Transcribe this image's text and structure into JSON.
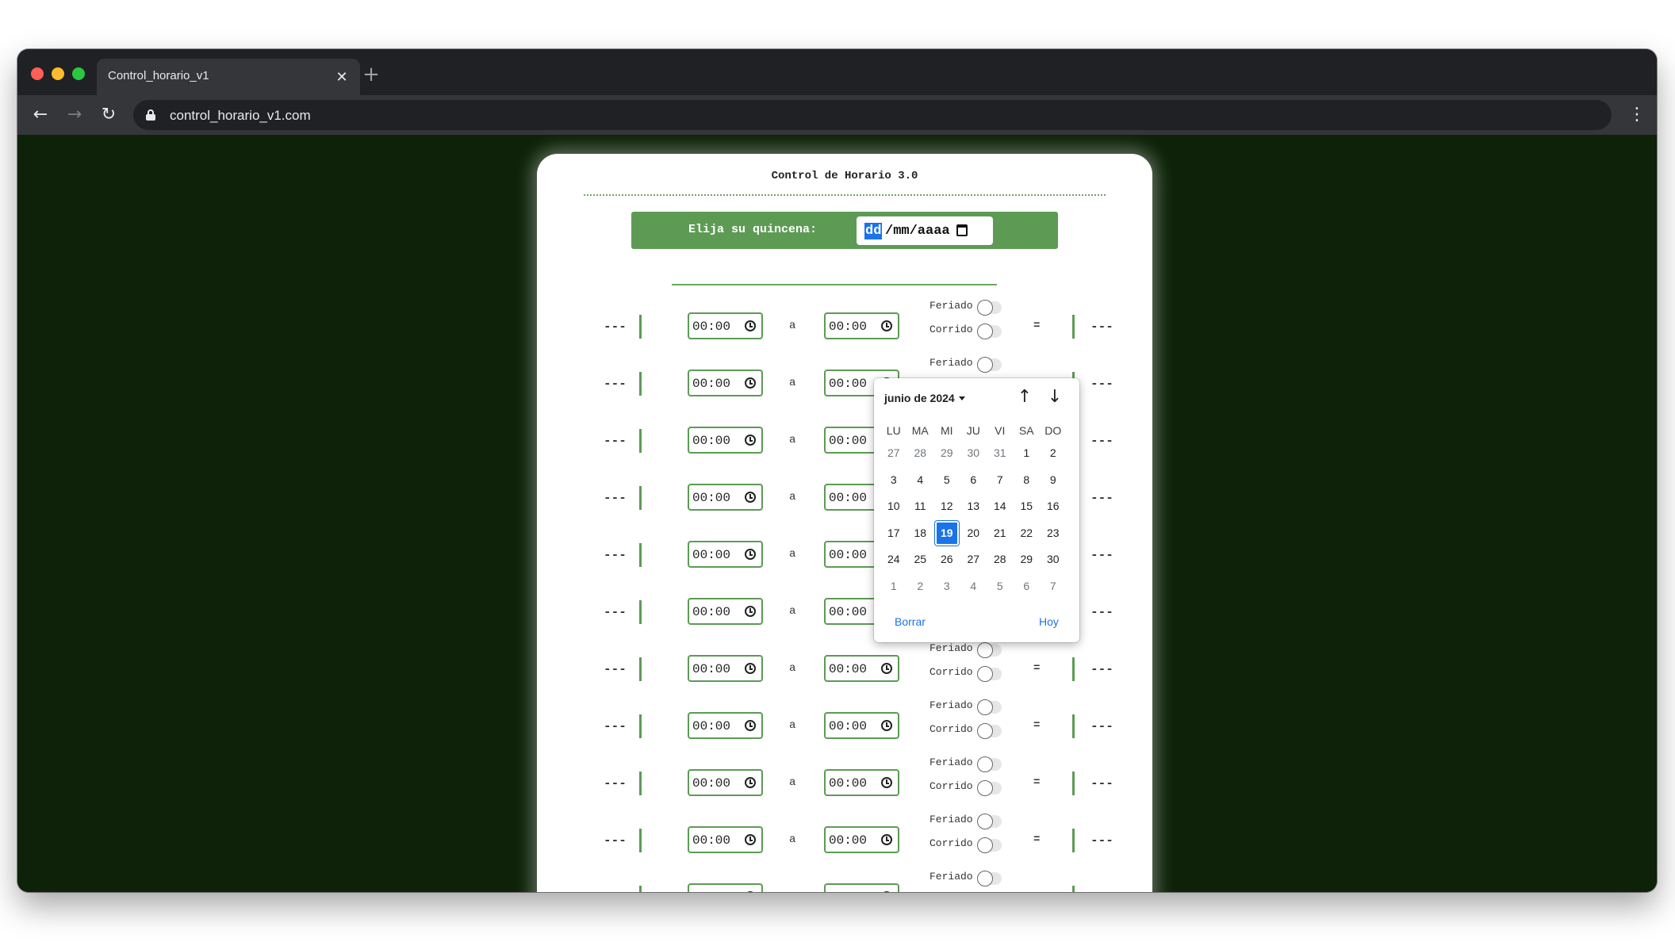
{
  "browser": {
    "tab_title": "Control_horario_v1",
    "tab_close": "✕",
    "new_tab": "+",
    "back": "←",
    "forward": "→",
    "reload": "↻",
    "url": "control_horario_v1.com",
    "menu": "⋮"
  },
  "page": {
    "title": "Control de Horario 3.0",
    "quincena_label": "Elija su quincena:",
    "date_day": "dd",
    "date_rest": "/mm/aaaa"
  },
  "labels": {
    "dash": "---",
    "a": "a",
    "equals": "=",
    "feriado": "Feriado",
    "corrido": "Corrido"
  },
  "rows": [
    {
      "from": "00:00",
      "to": "00:00",
      "feriado": false,
      "corrido": false
    },
    {
      "from": "00:00",
      "to": "00:00",
      "feriado": false,
      "corrido": false
    },
    {
      "from": "00:00",
      "to": "00:00",
      "feriado": false,
      "corrido": false
    },
    {
      "from": "00:00",
      "to": "00:00",
      "feriado": false,
      "corrido": false
    },
    {
      "from": "00:00",
      "to": "00:00",
      "feriado": false,
      "corrido": false
    },
    {
      "from": "00:00",
      "to": "00:00",
      "feriado": false,
      "corrido": false
    },
    {
      "from": "00:00",
      "to": "00:00",
      "feriado": false,
      "corrido": false
    },
    {
      "from": "00:00",
      "to": "00:00",
      "feriado": false,
      "corrido": false
    },
    {
      "from": "00:00",
      "to": "00:00",
      "feriado": false,
      "corrido": false
    },
    {
      "from": "00:00",
      "to": "00:00",
      "feriado": false,
      "corrido": false
    },
    {
      "from": "",
      "to": "",
      "feriado": false,
      "corrido": false
    }
  ],
  "datepicker": {
    "month_label": "junio de 2024",
    "up": "↑",
    "down": "↓",
    "weekdays": [
      "LU",
      "MA",
      "MI",
      "JU",
      "VI",
      "SA",
      "DO"
    ],
    "weeks": [
      [
        "27",
        "28",
        "29",
        "30",
        "31",
        "1",
        "2"
      ],
      [
        "3",
        "4",
        "5",
        "6",
        "7",
        "8",
        "9"
      ],
      [
        "10",
        "11",
        "12",
        "13",
        "14",
        "15",
        "16"
      ],
      [
        "17",
        "18",
        "19",
        "20",
        "21",
        "22",
        "23"
      ],
      [
        "24",
        "25",
        "26",
        "27",
        "28",
        "29",
        "30"
      ],
      [
        "1",
        "2",
        "3",
        "4",
        "5",
        "6",
        "7"
      ]
    ],
    "selected": "19",
    "clear_label": "Borrar",
    "today_label": "Hoy"
  }
}
